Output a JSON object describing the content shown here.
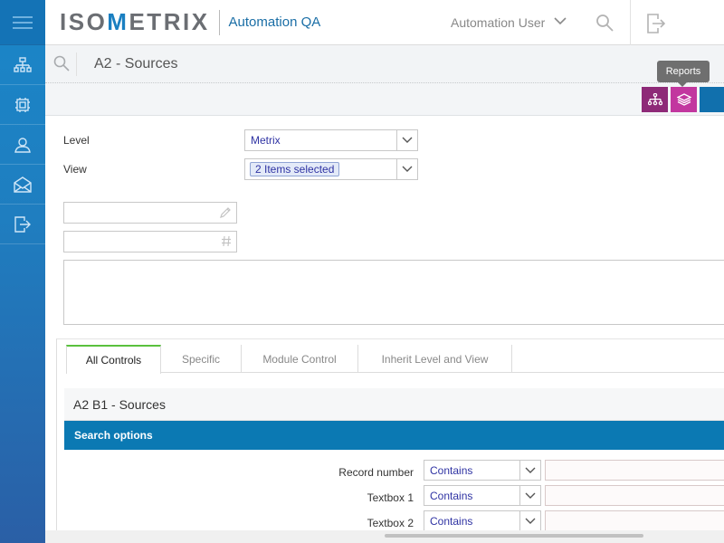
{
  "header": {
    "logo_left": "ISO",
    "logo_m": "M",
    "logo_right": "ETRIX",
    "app_name": "Automation QA",
    "user_name": "Automation User"
  },
  "sidebar": {
    "items": [
      {
        "icon": "org-chart-icon"
      },
      {
        "icon": "module-icon"
      },
      {
        "icon": "user-icon"
      },
      {
        "icon": "mail-icon"
      },
      {
        "icon": "logout-icon"
      }
    ]
  },
  "page": {
    "title": "A2 - Sources"
  },
  "actions": {
    "tooltip": "Reports"
  },
  "form": {
    "level_label": "Level",
    "level_value": "Metrix",
    "view_label": "View",
    "view_chip": "2 Items selected"
  },
  "tabs": [
    {
      "label": "All Controls",
      "active": true
    },
    {
      "label": "Specific"
    },
    {
      "label": "Module Control"
    },
    {
      "label": "Inherit Level and View"
    }
  ],
  "panel": {
    "title": "A2 B1 - Sources",
    "search_options": "Search options",
    "criteria": [
      {
        "label": "Record number",
        "op": "Contains"
      },
      {
        "label": "Textbox 1",
        "op": "Contains"
      },
      {
        "label": "Textbox 2",
        "op": "Contains"
      }
    ]
  },
  "colors": {
    "brand_blue": "#1a7fc1",
    "tree_button": "#8e2a78",
    "layers_button": "#c2379f",
    "search_options_bar": "#0b79b3",
    "active_tab_accent": "#5ac13e"
  }
}
